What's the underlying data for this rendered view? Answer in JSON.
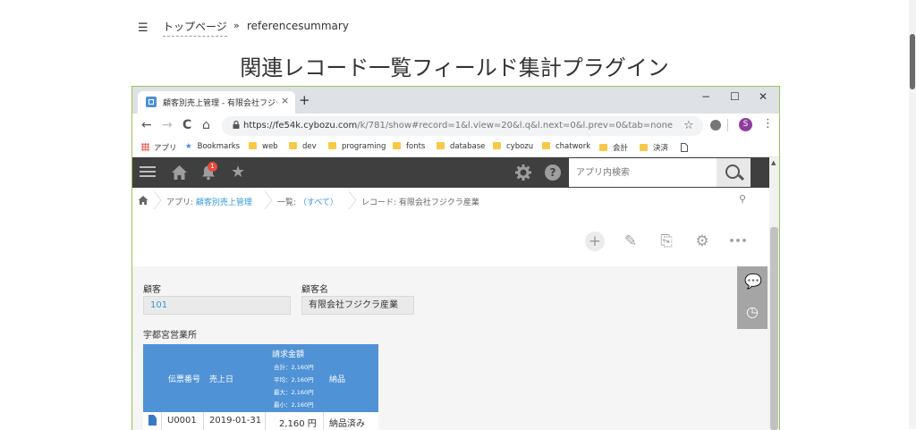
{
  "site": {
    "menu_icon": "☰",
    "breadcrumb": {
      "home": "トップページ",
      "sep": "»",
      "current": "referencesummary"
    },
    "title": "関連レコード一覧フィールド集計プラグイン"
  },
  "browser": {
    "tab_title": "顧客別売上管理 - 有限会社フジクラ産業",
    "tab_close": "×",
    "new_tab": "+",
    "window": {
      "minimize": "−",
      "maximize": "☐",
      "close": "✕"
    },
    "nav": {
      "back": "←",
      "forward": "→",
      "reload": "C",
      "home": "⌂"
    },
    "url_host": "https://fe54k.cybozu.com",
    "url_path": "/k/781/show#record=1&l.view=20&l.q&l.next=0&l.prev=0&tab=none",
    "star": "☆",
    "avatar_letter": "S",
    "kebab": "⋮",
    "bookmarks": {
      "apps": "アプリ",
      "bookmarks": "Bookmarks",
      "folders": [
        "web",
        "dev",
        "programing",
        "fonts",
        "database",
        "cybozu",
        "chatwork",
        "会計",
        "決済"
      ]
    }
  },
  "kintone": {
    "notification_count": "1",
    "help": "?",
    "search_placeholder": "アプリ内検索",
    "breadcrumb": {
      "app_prefix": "アプリ: ",
      "app_name": "顧客別売上管理",
      "list_prefix": "一覧: ",
      "list_name": "（すべて）",
      "record": "レコード: 有限会社フジクラ産業"
    },
    "actions": {
      "add": "+",
      "edit": "✎",
      "copy": "⎘",
      "settings": "⚙",
      "more": "•••"
    },
    "fields": {
      "customer_label": "顧客",
      "customer_value": "101",
      "customer_name_label": "顧客名",
      "customer_name_value": "有限会社フジクラ産業",
      "office_label": "宇都宮営業所"
    },
    "table": {
      "headers": {
        "slip_no": "伝票番号",
        "sales_date": "売上日",
        "amount": "請求金額",
        "delivery": "納品"
      },
      "summary": {
        "total": "合計：2,160円",
        "average": "平均：2,160円",
        "max": "最大：2,160円",
        "min": "最小：2,160円"
      },
      "rows": [
        {
          "slip_no": "U0001",
          "sales_date": "2019-01-31",
          "amount": "2,160 円",
          "delivery": "納品済み"
        }
      ]
    }
  },
  "colors": {
    "kintone_header": "#3f3f3f",
    "table_header": "#4f92d6",
    "link": "#3498db",
    "badge": "#e74c3c",
    "avatar": "#8e3d9e"
  }
}
